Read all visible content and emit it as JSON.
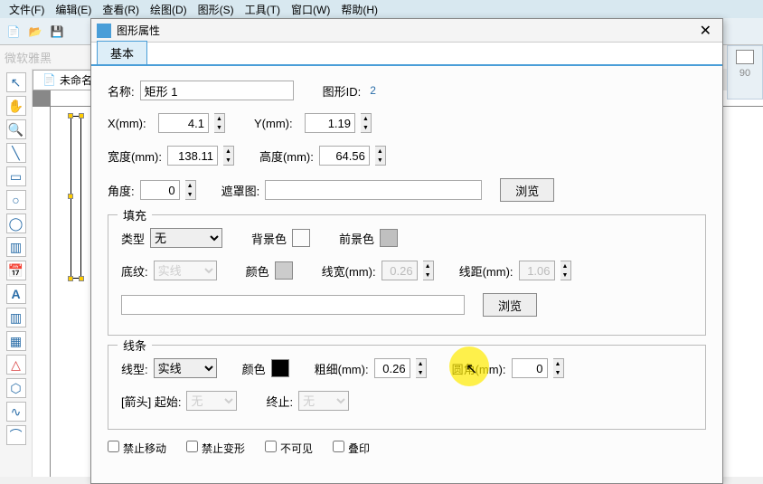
{
  "menu": {
    "file": "文件(F)",
    "edit": "编辑(E)",
    "view": "查看(R)",
    "draw": "绘图(D)",
    "shape": "图形(S)",
    "tool": "工具(T)",
    "window": "窗口(W)",
    "help": "帮助(H)"
  },
  "font_name": "微软雅黑",
  "doc_tab": {
    "icon": "📄",
    "title": "未命名"
  },
  "right_label": "90",
  "dialog": {
    "title": "图形属性",
    "tab_basic": "基本",
    "name_label": "名称:",
    "name_value": "矩形 1",
    "shapeid_label": "图形ID:",
    "shapeid_value": "2",
    "x_label": "X(mm):",
    "x_value": "4.1",
    "y_label": "Y(mm):",
    "y_value": "1.19",
    "width_label": "宽度(mm):",
    "width_value": "138.11",
    "height_label": "高度(mm):",
    "height_value": "64.56",
    "angle_label": "角度:",
    "angle_value": "0",
    "mask_label": "遮罩图:",
    "browse": "浏览",
    "fill": {
      "title": "填充",
      "type_label": "类型",
      "type_value": "无",
      "backcolor_label": "背景色",
      "forecolor_label": "前景色",
      "texture_label": "底纹:",
      "texture_value": "实线",
      "color_label": "颜色",
      "linewidth_label": "线宽(mm):",
      "linewidth_value": "0.26",
      "linedist_label": "线距(mm):",
      "linedist_value": "1.06"
    },
    "line": {
      "title": "线条",
      "type_label": "线型:",
      "type_value": "实线",
      "color_label": "颜色",
      "thick_label": "粗细(mm):",
      "thick_value": "0.26",
      "round_label": "圆角(mm):",
      "round_value": "0",
      "arrow_label": "[箭头] 起始:",
      "arrow_start": "无",
      "end_label": "终止:",
      "arrow_end": "无"
    },
    "checks": {
      "no_move": "禁止移动",
      "no_deform": "禁止变形",
      "invisible": "不可见",
      "overprint": "叠印"
    }
  },
  "colors": {
    "fill_back": "#ffffff",
    "fill_fore": "#c0c0c0",
    "fill_color": "#cccccc",
    "line_color": "#000000"
  }
}
